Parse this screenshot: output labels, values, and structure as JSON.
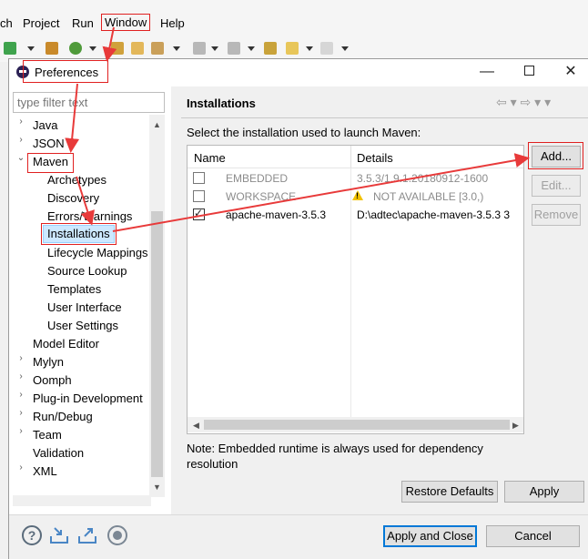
{
  "menu": {
    "items": [
      "ch",
      "Project",
      "Run",
      "Window",
      "Help"
    ]
  },
  "dialog": {
    "title": "Preferences",
    "filter_placeholder": "type filter text",
    "page_title": "Installations",
    "nav": "⇦ ▾ ⇨ ▾ ▾"
  },
  "tree": {
    "items": [
      {
        "label": "Java"
      },
      {
        "label": "JSON"
      },
      {
        "label": "Maven"
      },
      {
        "label": "Archetypes"
      },
      {
        "label": "Discovery"
      },
      {
        "label": "Errors/Warnings"
      },
      {
        "label": "Installations"
      },
      {
        "label": "Lifecycle Mappings"
      },
      {
        "label": "Source Lookup"
      },
      {
        "label": "Templates"
      },
      {
        "label": "User Interface"
      },
      {
        "label": "User Settings"
      },
      {
        "label": "Model Editor"
      },
      {
        "label": "Mylyn"
      },
      {
        "label": "Oomph"
      },
      {
        "label": "Plug-in Development"
      },
      {
        "label": "Run/Debug"
      },
      {
        "label": "Team"
      },
      {
        "label": "Validation"
      },
      {
        "label": "XML"
      }
    ]
  },
  "installations": {
    "instruction": "Select the installation used to launch Maven:",
    "columns": [
      "Name",
      "Details"
    ],
    "rows": [
      {
        "name": "EMBEDDED",
        "details": "3.5.3/1.9.1.20180912-1600",
        "checked": false,
        "enabled": false
      },
      {
        "name": "WORKSPACE",
        "details": "NOT AVAILABLE [3.0,)",
        "checked": false,
        "enabled": false
      },
      {
        "name": "apache-maven-3.5.3",
        "details": "D:\\adtec\\apache-maven-3.5.3 3",
        "checked": true,
        "enabled": true
      }
    ],
    "note": "Note: Embedded runtime is always used for dependency resolution"
  },
  "buttons": {
    "add": "Add...",
    "edit": "Edit...",
    "remove": "Remove",
    "restore_defaults": "Restore Defaults",
    "apply": "Apply",
    "apply_and_close": "Apply and Close",
    "cancel": "Cancel"
  },
  "colors": {
    "annotation": "#e83a3a",
    "selection": "#cce8ff"
  }
}
